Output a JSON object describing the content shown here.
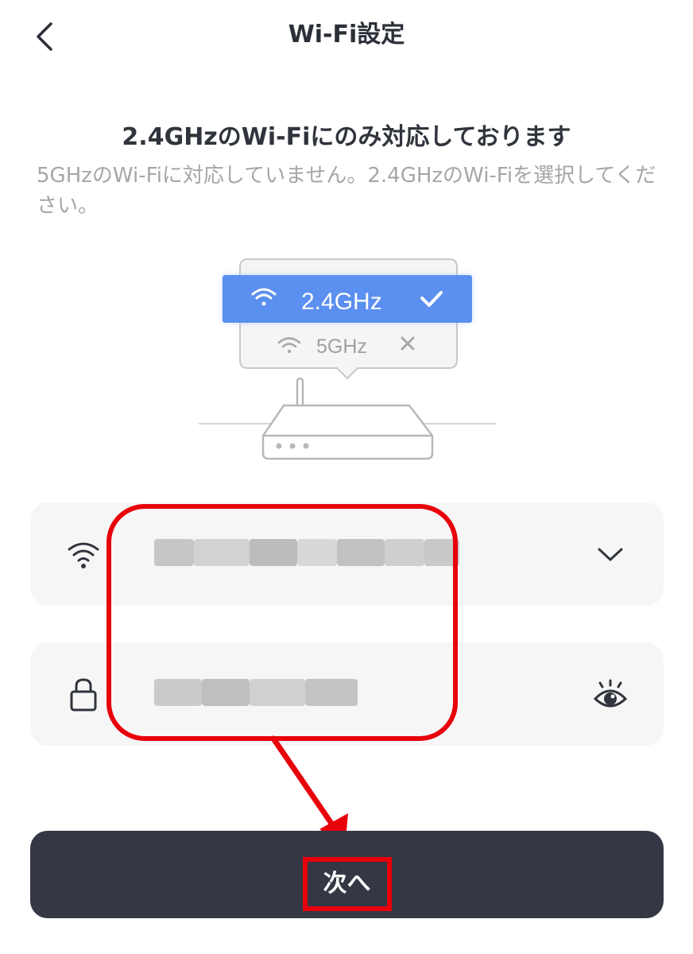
{
  "header": {
    "title": "Wi-Fi設定"
  },
  "intro": {
    "headline": "2.4GHzのWi-Fiにのみ対応しております",
    "subtext": "5GHzのWi-Fiに対応していません。2.4GHzのWi-Fiを選択してください。"
  },
  "illustration": {
    "option_24": "2.4GHz",
    "option_5": "5GHz"
  },
  "ssid_field": {
    "value": "",
    "obscured": true
  },
  "password_field": {
    "value": "",
    "obscured": true
  },
  "next_button": {
    "label": "次へ"
  },
  "colors": {
    "accent_blue": "#5b8ff0",
    "button_dark": "#343844",
    "annotation_red": "#e8000b",
    "subtext_gray": "#a6a6a6",
    "field_bg": "#f6f6f6"
  }
}
